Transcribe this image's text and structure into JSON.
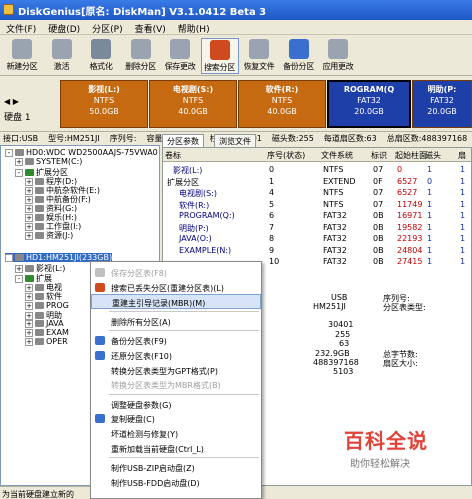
{
  "window": {
    "title": "DiskGenius[原名: DiskMan] V3.1.0412 Beta 3"
  },
  "menu": [
    "文件(F)",
    "硬盘(D)",
    "分区(P)",
    "查看(V)",
    "帮助(H)"
  ],
  "toolbar": [
    {
      "label": "新建分区",
      "icon": "new-partition-icon",
      "color": "#9aa4b0"
    },
    {
      "label": "激活",
      "icon": "activate-icon",
      "color": "#9aa4b0"
    },
    {
      "label": "格式化",
      "icon": "format-icon",
      "color": "#7a8a9a"
    },
    {
      "label": "删除分区",
      "icon": "delete-partition-icon",
      "color": "#9aa4b0"
    },
    {
      "label": "保存更改",
      "icon": "save-icon",
      "color": "#9aa4b0"
    },
    {
      "label": "搜索分区",
      "icon": "search-partition-icon",
      "color": "#d04a20"
    },
    {
      "label": "恢复文件",
      "icon": "recover-file-icon",
      "color": "#9aa4b0"
    },
    {
      "label": "备份分区",
      "icon": "backup-partition-icon",
      "color": "#3b6fcf"
    },
    {
      "label": "应用更改",
      "icon": "apply-icon",
      "color": "#9aa4b0"
    }
  ],
  "diskbar": {
    "label": "硬盘 1",
    "arrows": "◀ ▶",
    "segments": [
      {
        "name": "影视(L:)",
        "fs": "NTFS",
        "size": "50.0GB",
        "color": "#c66a12",
        "sel": false
      },
      {
        "name": "电视剧(S:)",
        "fs": "NTFS",
        "size": "40.0GB",
        "color": "#c66a12",
        "sel": false
      },
      {
        "name": "软件(R:)",
        "fs": "NTFS",
        "size": "40.0GB",
        "color": "#c66a12",
        "sel": false
      },
      {
        "name": "ROGRAM(Q",
        "fs": "FAT32",
        "size": "20.0GB",
        "color": "#1f3fa8",
        "sel": true
      },
      {
        "name": "明助(P:",
        "fs": "FAT32",
        "size": "20.0GB",
        "color": "#1f3fa8",
        "sel": false
      }
    ]
  },
  "info": [
    "接口:USB",
    "型号:HM251JI",
    "序列号:",
    "容量:232.9GB",
    "柱面数:30401",
    "磁头数:255",
    "每道扇区数:63",
    "总扇区数:488397168"
  ],
  "tree": [
    {
      "text": "HD0:WDC WD2500AAJS-75VWA0",
      "exp": "-",
      "ind": 0,
      "sel": false
    },
    {
      "text": "SYSTEM(C:)",
      "exp": "+",
      "ind": 1,
      "sel": false
    },
    {
      "text": "扩展分区",
      "exp": "-",
      "ind": 1,
      "sel": false,
      "green": true
    },
    {
      "text": "程序(D:)",
      "exp": "+",
      "ind": 2,
      "sel": false
    },
    {
      "text": "中航杂软件(E:)",
      "exp": "+",
      "ind": 2,
      "sel": false
    },
    {
      "text": "中航备份(F:)",
      "exp": "+",
      "ind": 2,
      "sel": false
    },
    {
      "text": "资料(G:)",
      "exp": "+",
      "ind": 2,
      "sel": false
    },
    {
      "text": "娱乐(H:)",
      "exp": "+",
      "ind": 2,
      "sel": false
    },
    {
      "text": "工作盘(I:)",
      "exp": "+",
      "ind": 2,
      "sel": false
    },
    {
      "text": "资源(J:)",
      "exp": "+",
      "ind": 2,
      "sel": false
    },
    {
      "text": "HD1:HM251JI(233GB)",
      "exp": "-",
      "ind": 0,
      "sel": true
    },
    {
      "text": "影视(L:)",
      "exp": "+",
      "ind": 1,
      "sel": false
    },
    {
      "text": "扩展",
      "exp": "-",
      "ind": 1,
      "sel": false,
      "green": true
    },
    {
      "text": "电视",
      "exp": "+",
      "ind": 2,
      "sel": false
    },
    {
      "text": "软件",
      "exp": "+",
      "ind": 2,
      "sel": false
    },
    {
      "text": "PROG",
      "exp": "+",
      "ind": 2,
      "sel": false
    },
    {
      "text": "明助",
      "exp": "+",
      "ind": 2,
      "sel": false
    },
    {
      "text": "JAVA",
      "exp": "+",
      "ind": 2,
      "sel": false
    },
    {
      "text": "EXAM",
      "exp": "+",
      "ind": 2,
      "sel": false
    },
    {
      "text": "OPER",
      "exp": "+",
      "ind": 2,
      "sel": false
    }
  ],
  "tabs": [
    "分区参数",
    "浏览文件"
  ],
  "table": {
    "headers": [
      "卷标",
      "序号(状态)",
      "文件系统",
      "标识",
      "起始柱面",
      "磁头",
      "扇"
    ],
    "rows": [
      {
        "label": "影视(L:)",
        "idx": "0",
        "fs": "NTFS",
        "id": "07",
        "cyl": "0",
        "head": "1",
        "sec": "1",
        "ind": 1,
        "ext": false
      },
      {
        "label": "扩展分区",
        "idx": "1",
        "fs": "EXTEND",
        "id": "0F",
        "cyl": "6527",
        "head": "0",
        "sec": "1",
        "ind": 0,
        "ext": true
      },
      {
        "label": "电视剧(S:)",
        "idx": "4",
        "fs": "NTFS",
        "id": "07",
        "cyl": "6527",
        "head": "1",
        "sec": "1",
        "ind": 2,
        "ext": false
      },
      {
        "label": "软件(R:)",
        "idx": "5",
        "fs": "NTFS",
        "id": "07",
        "cyl": "11749",
        "head": "1",
        "sec": "1",
        "ind": 2,
        "ext": false
      },
      {
        "label": "PROGRAM(Q:)",
        "idx": "6",
        "fs": "FAT32",
        "id": "0B",
        "cyl": "16971",
        "head": "1",
        "sec": "1",
        "ind": 2,
        "ext": false
      },
      {
        "label": "明助(P:)",
        "idx": "7",
        "fs": "FAT32",
        "id": "0B",
        "cyl": "19582",
        "head": "1",
        "sec": "1",
        "ind": 2,
        "ext": false
      },
      {
        "label": "JAVA(O:)",
        "idx": "8",
        "fs": "FAT32",
        "id": "0B",
        "cyl": "22193",
        "head": "1",
        "sec": "1",
        "ind": 2,
        "ext": false
      },
      {
        "label": "EXAMPLE(N:)",
        "idx": "9",
        "fs": "FAT32",
        "id": "0B",
        "cyl": "24804",
        "head": "1",
        "sec": "1",
        "ind": 2,
        "ext": false
      },
      {
        "label": "",
        "idx": "10",
        "fs": "FAT32",
        "id": "0B",
        "cyl": "27415",
        "head": "1",
        "sec": "1",
        "ind": 2,
        "ext": false
      }
    ]
  },
  "details": {
    "interface": "USB",
    "model": "HM251JI",
    "serial_label": "序列号:",
    "ptype_label": "分区表类型:",
    "cyl": "30401",
    "heads": "255",
    "spt": "63",
    "cap": "232.9GB",
    "total_label": "总字节数:",
    "total": "488397168",
    "sector_label": "扇区大小:",
    "num": "5103"
  },
  "context_menu": [
    {
      "label": "保存分区表(F8)",
      "dis": true,
      "icon": "save-icon",
      "color": "#c0c0c0"
    },
    {
      "label": "搜索已丢失分区(重建分区表)(L)",
      "dis": false,
      "icon": "search-partition-icon",
      "color": "#d04a20"
    },
    {
      "label": "重建主引导记录(MBR)(M)",
      "dis": false,
      "hi": true,
      "icon": "",
      "color": ""
    },
    {
      "sep": true
    },
    {
      "label": "删除所有分区(A)",
      "dis": false,
      "icon": "",
      "color": ""
    },
    {
      "sep": true
    },
    {
      "label": "备份分区表(F9)",
      "dis": false,
      "icon": "backup-icon",
      "color": "#3b6fcf"
    },
    {
      "label": "还原分区表(F10)",
      "dis": false,
      "icon": "restore-icon",
      "color": "#3b6fcf"
    },
    {
      "label": "转换分区表类型为GPT格式(P)",
      "dis": false,
      "icon": "",
      "color": ""
    },
    {
      "label": "转换分区表类型为MBR格式(B)",
      "dis": true,
      "icon": "",
      "color": ""
    },
    {
      "sep": true
    },
    {
      "label": "调整硬盘参数(G)",
      "dis": false,
      "icon": "",
      "color": ""
    },
    {
      "label": "复制硬盘(C)",
      "dis": false,
      "icon": "copy-disk-icon",
      "color": "#3b6fcf"
    },
    {
      "label": "坏道检测与修复(Y)",
      "dis": false,
      "icon": "",
      "color": ""
    },
    {
      "label": "重新加载当前硬盘(Ctrl_L)",
      "dis": false,
      "icon": "",
      "color": ""
    },
    {
      "sep": true
    },
    {
      "label": "制作USB-ZIP启动盘(Z)",
      "dis": false,
      "icon": "",
      "color": ""
    },
    {
      "label": "制作USB-FDD启动盘(D)",
      "dis": false,
      "icon": "",
      "color": ""
    }
  ],
  "status": "为当前硬盘建立新的",
  "watermark": {
    "title": "百科全说",
    "sub": "助你轻松解决"
  }
}
